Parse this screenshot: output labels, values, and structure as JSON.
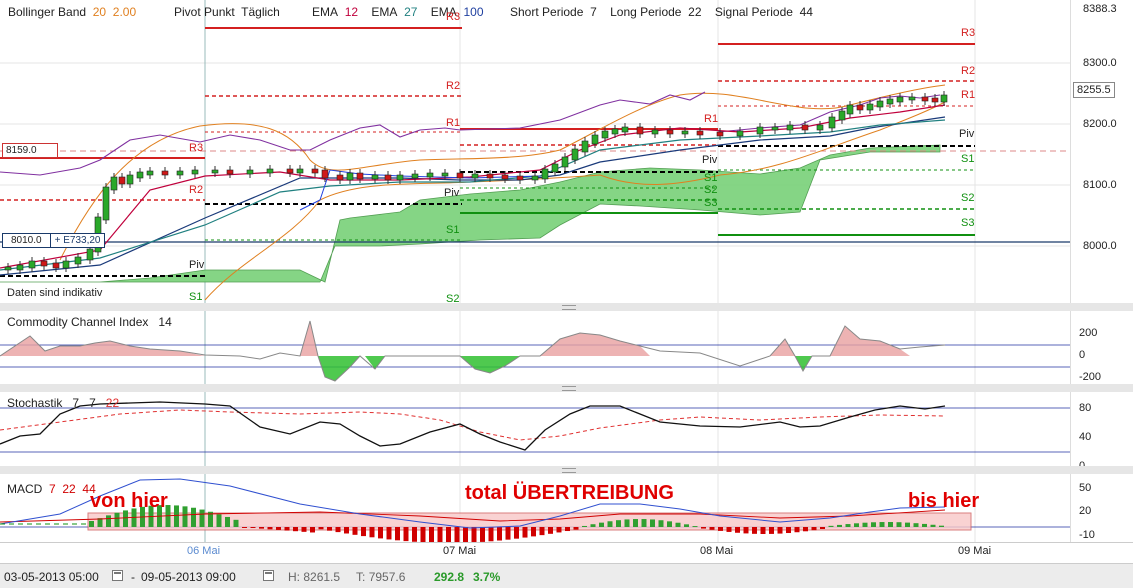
{
  "legend": {
    "bollinger_label": "Bollinger Band",
    "bollinger_p1": "20",
    "bollinger_p2": "2.00",
    "pivot_label": "Pivot Punkt",
    "pivot_period": "Täglich",
    "ema1_label": "EMA",
    "ema1_value": "12",
    "ema2_label": "EMA",
    "ema2_value": "27",
    "ema3_label": "EMA",
    "ema3_value": "100",
    "short_label": "Short Periode",
    "short_value": "7",
    "long_label": "Long Periode",
    "long_value": "22",
    "signal_label": "Signal Periode",
    "signal_value": "44"
  },
  "colors": {
    "resistance": "#d42020",
    "support": "#109010",
    "bollinger": "#e08020",
    "ema12": "#c0003c",
    "ema27": "#208080",
    "ema100": "#2040a0",
    "cloud": "#7fd37f",
    "cci_fill_pos": "#e8a0a0",
    "cci_fill_neg": "#30c030",
    "stoch_signal": "#e03030",
    "macd_pos": "#30a030",
    "macd_neg": "#d00000"
  },
  "main_axis": [
    "8388.3",
    "8300.0",
    "8200.0",
    "8100.0",
    "8000.0"
  ],
  "price_tag": "8255.5",
  "left_box_1": "8159.0",
  "left_box_2a": "8010.0",
  "left_box_2b": "+ E733,20",
  "disclaimer": "Daten sind indikativ",
  "pivot_labels": {
    "day1": {
      "R3": "R3",
      "R2": "R2",
      "Piv": "Piv",
      "S1": "S1"
    },
    "day2": {
      "R3": "R3",
      "R2": "R2",
      "R1": "R1",
      "Piv": "Piv",
      "S1": "S1",
      "S2": "S2"
    },
    "day3": {
      "R1": "R1",
      "Piv": "Piv",
      "S1": "S1",
      "S2": "S2",
      "S3": "S3"
    },
    "day4": {
      "R3": "R3",
      "R2": "R2",
      "R1": "R1",
      "Piv": "Piv",
      "S1": "S1",
      "S2": "S2",
      "S3": "S3"
    }
  },
  "cci": {
    "label": "Commodity Channel Index",
    "period": "14",
    "axis": [
      "200",
      "0",
      "-200"
    ]
  },
  "stoch": {
    "label": "Stochastik",
    "p1": "7",
    "p2": "7",
    "p3": "22",
    "axis": [
      "80",
      "40",
      "0"
    ]
  },
  "macd": {
    "label": "MACD",
    "p1": "7",
    "p2": "22",
    "p3": "44",
    "axis": [
      "50",
      "20",
      "-10"
    ]
  },
  "annotations": {
    "left": "von hier",
    "middle": "total ÜBERTREIBUNG",
    "right": "bis hier"
  },
  "x_axis": [
    "06 Mai",
    "07 Mai",
    "08 Mai",
    "09 Mai"
  ],
  "footer": {
    "from": "03-05-2013 05:00",
    "to": "09-05-2013 09:00",
    "high_label": "H:",
    "high": "8261.5",
    "low_label": "T:",
    "low": "7957.6",
    "change": "292.8",
    "change_pct": "3.7%"
  }
}
